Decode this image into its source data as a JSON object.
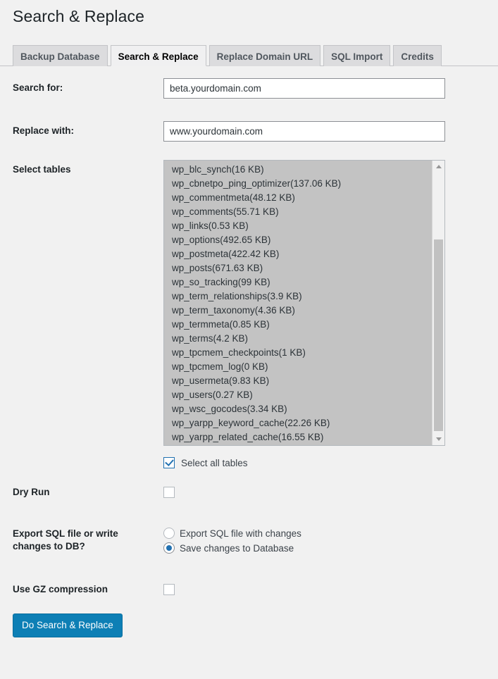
{
  "page": {
    "title": "Search & Replace"
  },
  "tabs": [
    {
      "label": "Backup Database",
      "active": false
    },
    {
      "label": "Search & Replace",
      "active": true
    },
    {
      "label": "Replace Domain URL",
      "active": false
    },
    {
      "label": "SQL Import",
      "active": false
    },
    {
      "label": "Credits",
      "active": false
    }
  ],
  "form": {
    "search_for": {
      "label": "Search for:",
      "value": "beta.yourdomain.com",
      "placeholder": ""
    },
    "replace_with": {
      "label": "Replace with:",
      "value": "www.yourdomain.com",
      "placeholder": ""
    },
    "select_tables": {
      "label": "Select tables",
      "options": [
        "wp_blc_synch(16 KB)",
        "wp_cbnetpo_ping_optimizer(137.06 KB)",
        "wp_commentmeta(48.12 KB)",
        "wp_comments(55.71 KB)",
        "wp_links(0.53 KB)",
        "wp_options(492.65 KB)",
        "wp_postmeta(422.42 KB)",
        "wp_posts(671.63 KB)",
        "wp_so_tracking(99 KB)",
        "wp_term_relationships(3.9 KB)",
        "wp_term_taxonomy(4.36 KB)",
        "wp_termmeta(0.85 KB)",
        "wp_terms(4.2 KB)",
        "wp_tpcmem_checkpoints(1 KB)",
        "wp_tpcmem_log(0 KB)",
        "wp_usermeta(9.83 KB)",
        "wp_users(0.27 KB)",
        "wp_wsc_gocodes(3.34 KB)",
        "wp_yarpp_keyword_cache(22.26 KB)",
        "wp_yarpp_related_cache(16.55 KB)"
      ]
    },
    "select_all": {
      "label": "Select all tables",
      "checked": true
    },
    "dry_run": {
      "label": "Dry Run",
      "checked": false
    },
    "export_mode": {
      "label": "Export SQL file or write changes to DB?",
      "options": [
        {
          "label": "Export SQL file with changes",
          "selected": false
        },
        {
          "label": "Save changes to Database",
          "selected": true
        }
      ]
    },
    "gz_compression": {
      "label": "Use GZ compression",
      "checked": false
    },
    "submit": {
      "label": "Do Search & Replace"
    }
  },
  "colors": {
    "page_background": "#f1f1f1",
    "accent_blue": "#0d7fb5",
    "checkbox_blue": "#2271b1",
    "list_background": "#c3c3c3",
    "text": "#3c434a",
    "heading": "#1d2327"
  },
  "icons": {
    "scroll_up": "scroll-up-arrow-icon",
    "scroll_down": "scroll-down-arrow-icon",
    "check": "check-icon"
  }
}
